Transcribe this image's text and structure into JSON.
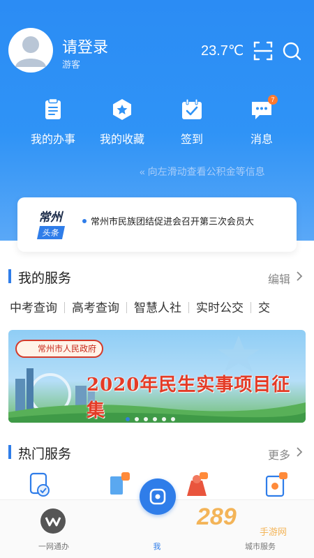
{
  "header": {
    "login_label": "请登录",
    "user_role": "游客",
    "temperature": "23.7℃"
  },
  "quick_actions": [
    {
      "label": "我的办事",
      "icon": "document-list-icon"
    },
    {
      "label": "我的收藏",
      "icon": "star-hexagon-icon"
    },
    {
      "label": "签到",
      "icon": "calendar-check-icon"
    },
    {
      "label": "消息",
      "icon": "chat-bubble-icon",
      "badge": "7"
    }
  ],
  "swipe_hint": "« 向左滑动查看公积金等信息",
  "news": {
    "brand_top": "常州",
    "brand_bottom": "头条",
    "headline": "常州市民族团结促进会召开第三次会员大"
  },
  "my_services": {
    "title": "我的服务",
    "action": "编辑",
    "items": [
      "中考查询",
      "高考查询",
      "智慧人社",
      "实时公交",
      "交"
    ]
  },
  "banner": {
    "logo_text": "常州市人民政府",
    "title": "2020年民生实事项目征集",
    "dots": 6,
    "active_dot": 0
  },
  "hot_services": {
    "title": "热门服务",
    "action": "更多"
  },
  "tabbar": {
    "tabs": [
      {
        "label": "一网通办"
      },
      {
        "label": "我"
      },
      {
        "label": "城市服务"
      }
    ]
  },
  "watermark": {
    "main": "289",
    "sub": "手游网"
  },
  "colors": {
    "primary": "#2f7de9",
    "header_bg": "#2b8cf4",
    "badge": "#ff7a2e",
    "banner_title": "#e43b26"
  }
}
